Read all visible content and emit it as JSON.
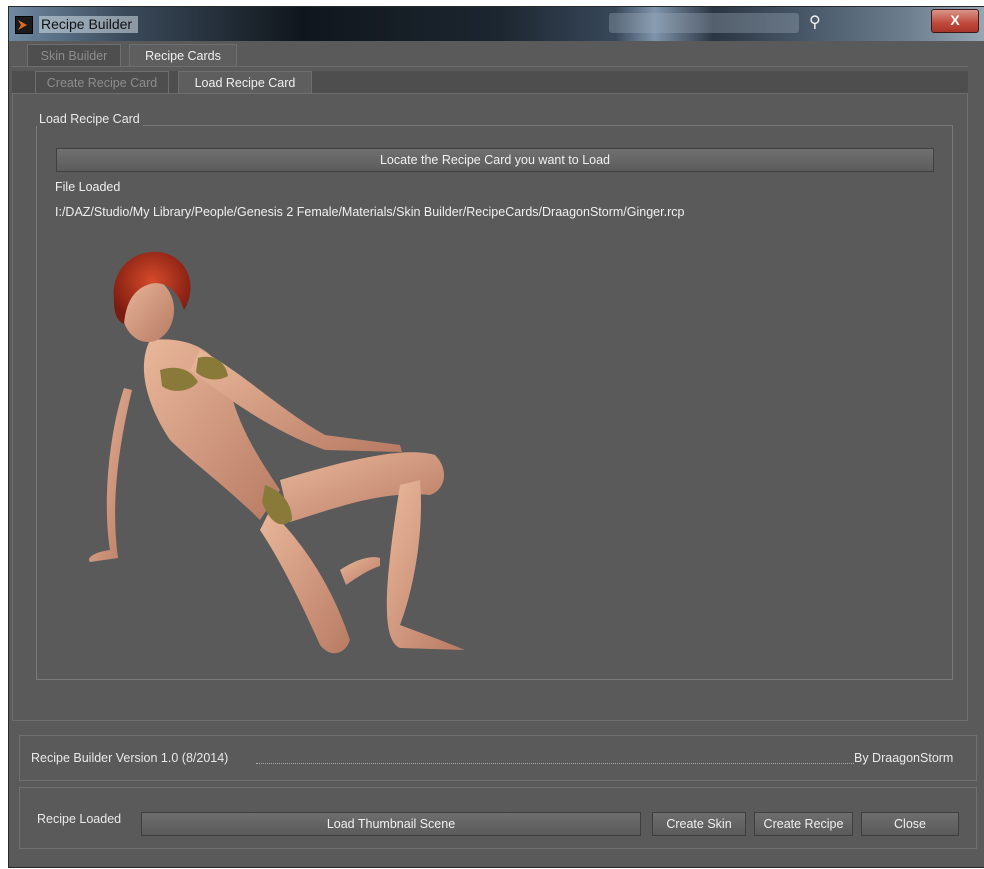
{
  "window": {
    "title": "Recipe Builder",
    "close_glyph": "X"
  },
  "tabs_top": [
    {
      "label": "Skin Builder",
      "active": false
    },
    {
      "label": "Recipe Cards",
      "active": true
    }
  ],
  "tabs_sub": [
    {
      "label": "Create Recipe Card",
      "active": false
    },
    {
      "label": "Load Recipe Card",
      "active": true
    }
  ],
  "load_panel": {
    "group_title": "Load Recipe Card",
    "locate_button": "Locate the Recipe Card you want to Load",
    "file_loaded_label": "File Loaded",
    "file_path": "I:/DAZ/Studio/My Library/People/Genesis 2 Female/Materials/Skin Builder/RecipeCards/DraagonStorm/Ginger.rcp"
  },
  "status": {
    "version_text": "Recipe Builder Version 1.0 (8/2014)",
    "author_text": "By DraagonStorm"
  },
  "bottom": {
    "recipe_loaded_label": "Recipe Loaded",
    "load_thumbnail_button": "Load Thumbnail Scene",
    "create_skin_button": "Create Skin",
    "create_recipe_button": "Create Recipe",
    "close_button": "Close"
  },
  "icons": {
    "app": "daz-logo-icon",
    "close": "close-icon",
    "search": "search-icon"
  },
  "colors": {
    "panel": "#5a5a5a",
    "close_button": "#c0493a",
    "hair": "#b5321e"
  }
}
